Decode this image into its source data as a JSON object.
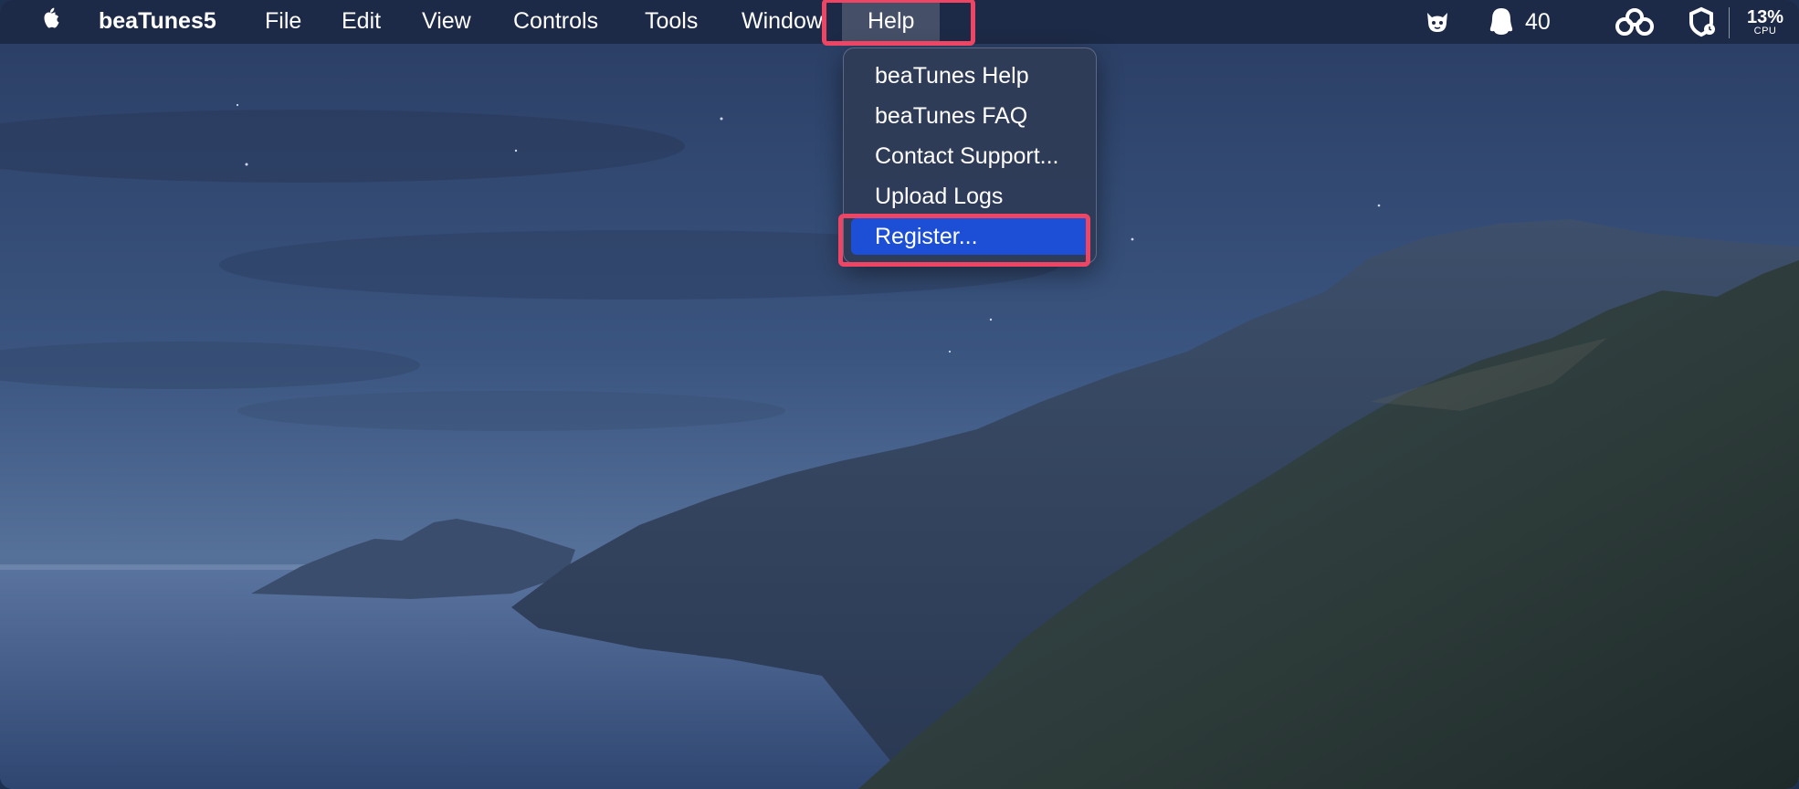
{
  "menubar": {
    "apple_icon": "apple-icon",
    "app_name": "beaTunes5",
    "menus": [
      "File",
      "Edit",
      "View",
      "Controls",
      "Tools",
      "Window",
      "Help"
    ],
    "status": {
      "cat_icon": "cat-face-icon",
      "qq_icon": "penguin-icon",
      "qq_count": "40",
      "cloud_icon": "cloud-icon",
      "shield_icon": "shield-clock-icon",
      "cpu_percent": "13%",
      "cpu_label": "CPU"
    }
  },
  "help_menu": {
    "items": [
      "beaTunes Help",
      "beaTunes FAQ",
      "Contact Support...",
      "Upload Logs",
      "Register..."
    ],
    "selected": "Register..."
  },
  "colors": {
    "highlight_border": "#ef4565",
    "selection": "#1c4fd6",
    "menubar_bg": "#1c2844"
  }
}
